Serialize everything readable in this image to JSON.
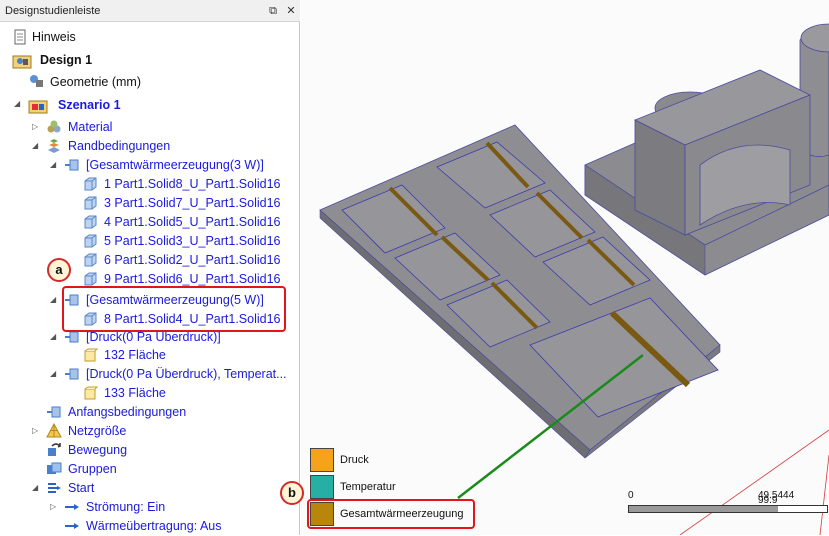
{
  "panel": {
    "title": "Designstudienleiste",
    "pin_icon": "pin-icon",
    "close_icon": "close-icon"
  },
  "tree": {
    "hinweis": "Hinweis",
    "design": "Design 1",
    "geometrie": "Geometrie (mm)",
    "szenario": "Szenario 1",
    "material": "Material",
    "randbedingungen": "Randbedingungen",
    "gw3": "[Gesamtwärmeerzeugung(3 W)]",
    "parts3": [
      "1 Part1.Solid8_U_Part1.Solid16",
      "3 Part1.Solid7_U_Part1.Solid16",
      "4 Part1.Solid5_U_Part1.Solid16",
      "5 Part1.Solid3_U_Part1.Solid16",
      "6 Part1.Solid2_U_Part1.Solid16",
      "9 Part1.Solid6_U_Part1.Solid16"
    ],
    "gw5": "[Gesamtwärmeerzeugung(5 W)]",
    "part5": "8 Part1.Solid4_U_Part1.Solid16",
    "druck1": "[Druck(0 Pa Überdruck)]",
    "flaeche132": "132 Fläche",
    "druck2": "[Druck(0 Pa Überdruck), Temperat...",
    "flaeche133": "133 Fläche",
    "anfangsbedingungen": "Anfangsbedingungen",
    "netzgroesse": "Netzgröße",
    "bewegung": "Bewegung",
    "gruppen": "Gruppen",
    "start": "Start",
    "stroemung": "Strömung: Ein",
    "waerme": "Wärmeübertragung: Aus"
  },
  "callouts": {
    "a": "a",
    "b": "b"
  },
  "legend": [
    {
      "label": "Druck",
      "color": "#f7a21b"
    },
    {
      "label": "Temperatur",
      "color": "#25b0a3"
    },
    {
      "label": "Gesamtwärmeerzeugung",
      "color": "#b8860b"
    }
  ],
  "scale": {
    "start": "0",
    "end_a": "49.5444",
    "end_b": "99.9"
  }
}
